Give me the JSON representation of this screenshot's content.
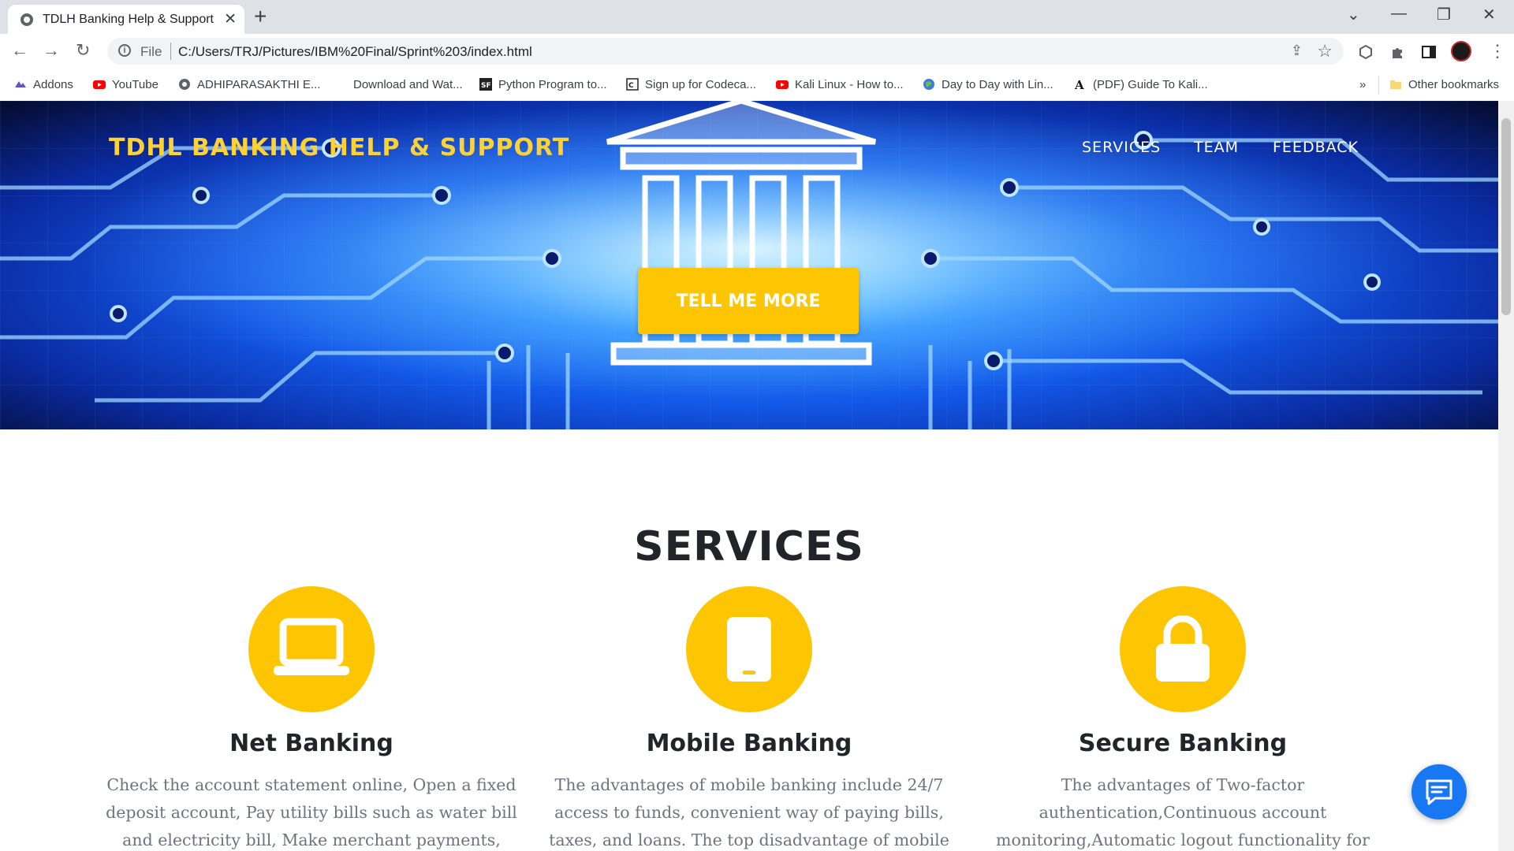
{
  "browser": {
    "tab_title": "TDLH Banking Help & Support",
    "tab_close": "✕",
    "new_tab": "+",
    "window_controls": {
      "dropdown": "⌄",
      "minimize": "—",
      "restore": "❐",
      "close": "✕"
    },
    "nav": {
      "back": "←",
      "forward": "→",
      "reload": "↻"
    },
    "address": {
      "scheme": "File",
      "url": "C:/Users/TRJ/Pictures/IBM%20Final/Sprint%203/index.html"
    },
    "bookmarks": [
      {
        "label": "Addons",
        "icon": "addons-icon"
      },
      {
        "label": "YouTube",
        "icon": "youtube-icon"
      },
      {
        "label": "ADHIPARASAKTHI E...",
        "icon": "globe-icon"
      },
      {
        "label": "Download and Wat...",
        "icon": "blank-icon"
      },
      {
        "label": "Python Program to...",
        "icon": "sf-icon"
      },
      {
        "label": "Sign up for Codeca...",
        "icon": "codecademy-icon"
      },
      {
        "label": "Kali Linux - How to...",
        "icon": "youtube-icon"
      },
      {
        "label": "Day to Day with Lin...",
        "icon": "globe-icon"
      },
      {
        "label": "(PDF) Guide To Kali...",
        "icon": "academia-icon"
      }
    ],
    "bookmarks_overflow": "»",
    "other_bookmarks": "Other bookmarks"
  },
  "site": {
    "brand": "TDHL BANKING HELP & SUPPORT",
    "nav": [
      "SERVICES",
      "TEAM",
      "FEEDBACK"
    ],
    "cta": "TELL ME MORE",
    "colors": {
      "accent": "#fec503",
      "brand_text": "#fed136",
      "heading": "#212529",
      "muted": "#6c757d",
      "chat": "#1877f2"
    }
  },
  "services": {
    "title": "SERVICES",
    "items": [
      {
        "icon": "laptop-icon",
        "title": "Net Banking",
        "text": "Check the account statement online, Open a fixed deposit account, Pay utility bills such as water bill and electricity bill, Make merchant payments, Transfer"
      },
      {
        "icon": "mobile-icon",
        "title": "Mobile Banking",
        "text": "The advantages of mobile banking include 24/7 access to funds, convenient way of paying bills, taxes, and loans. The top disadvantage of mobile banking is"
      },
      {
        "icon": "lock-icon",
        "title": "Secure Banking",
        "text": "The advantages of Two-factor authentication,Continuous account monitoring,Automatic logout functionality for online"
      }
    ]
  }
}
